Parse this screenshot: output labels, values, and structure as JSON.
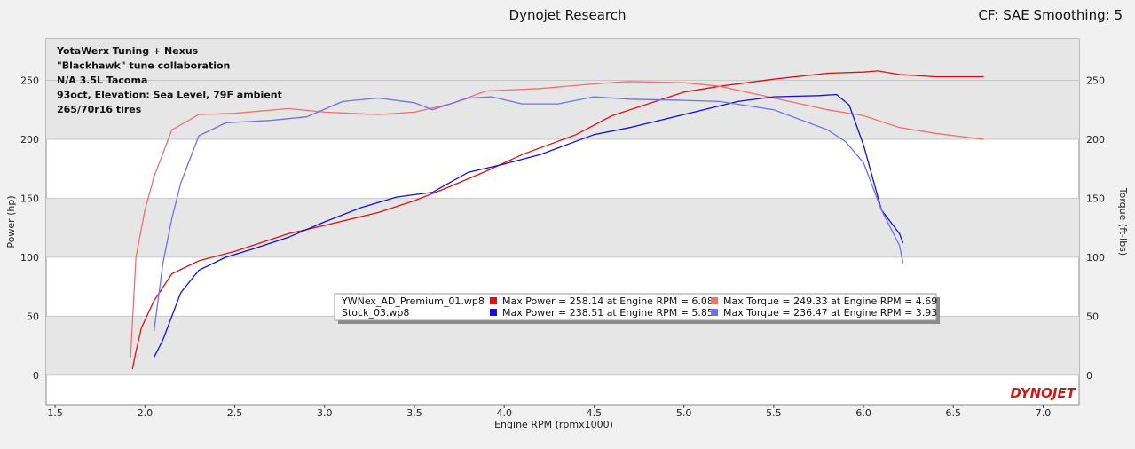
{
  "header": {
    "title": "Dynojet Research",
    "settings": "CF: SAE Smoothing: 5"
  },
  "chart_data": {
    "type": "line",
    "xlabel": "Engine RPM (rpmx1000)",
    "ylabel_left": "Power (hp)",
    "ylabel_right": "Torque (ft-lbs)",
    "xlim": [
      1.45,
      7.2
    ],
    "ylim": [
      -25,
      285
    ],
    "x_ticks": [
      "1.5",
      "2.0",
      "2.5",
      "3.0",
      "3.5",
      "4.0",
      "4.5",
      "5.0",
      "5.5",
      "6.0",
      "6.5",
      "7.0"
    ],
    "y_ticks": [
      "0",
      "50",
      "100",
      "150",
      "200",
      "250"
    ],
    "grid": true,
    "notes": [
      "YotaWerx Tuning + Nexus",
      "\"Blackhawk\" tune collaboration",
      "N/A 3.5L Tacoma",
      "93oct, Elevation: Sea Level, 79F ambient",
      "265/70r16 tires"
    ],
    "legend": [
      {
        "run": "YWNex_AD_Premium_01.wp8",
        "power_text": "Max Power = 258.14 at Engine RPM = 6.08",
        "torque_text": "Max Torque = 249.33 at Engine RPM = 4.69",
        "power_color": "#e01010",
        "torque_color": "#f07070"
      },
      {
        "run": "Stock_03.wp8",
        "power_text": "Max Power = 238.51 at Engine RPM = 5.85",
        "torque_text": "Max Torque = 236.47 at Engine RPM = 3.93",
        "power_color": "#1010e0",
        "torque_color": "#7070f0"
      }
    ],
    "logo": "DYNOJET",
    "series": [
      {
        "color": "#e01010",
        "x": [
          1.93,
          1.95,
          1.98,
          2.05,
          2.15,
          2.3,
          2.5,
          2.8,
          3.0,
          3.3,
          3.5,
          3.7,
          3.9,
          4.1,
          4.4,
          4.6,
          4.8,
          5.0,
          5.2,
          5.5,
          5.8,
          6.0,
          6.08,
          6.2,
          6.4,
          6.67
        ],
        "y": [
          5,
          20,
          40,
          63,
          86,
          97,
          105,
          120,
          127,
          138,
          148,
          160,
          173,
          187,
          204,
          220,
          230,
          240,
          245,
          251,
          256,
          257,
          258,
          255,
          253,
          253
        ]
      },
      {
        "color": "#f07070",
        "x": [
          1.92,
          1.95,
          2.0,
          2.05,
          2.15,
          2.3,
          2.5,
          2.8,
          3.0,
          3.3,
          3.5,
          3.7,
          3.9,
          4.2,
          4.5,
          4.69,
          5.0,
          5.2,
          5.5,
          5.8,
          6.0,
          6.2,
          6.4,
          6.67
        ],
        "y": [
          15,
          100,
          140,
          168,
          208,
          221,
          222,
          226,
          223,
          221,
          223,
          230,
          241,
          243,
          247,
          249,
          248,
          245,
          235,
          225,
          220,
          210,
          205,
          200
        ]
      },
      {
        "color": "#1010e0",
        "x": [
          2.05,
          2.1,
          2.2,
          2.3,
          2.45,
          2.6,
          2.8,
          3.0,
          3.2,
          3.4,
          3.6,
          3.8,
          4.0,
          4.2,
          4.5,
          4.7,
          5.0,
          5.3,
          5.5,
          5.75,
          5.85,
          5.92,
          6.0,
          6.1,
          6.2,
          6.22
        ],
        "y": [
          15,
          30,
          70,
          89,
          100,
          107,
          117,
          130,
          142,
          151,
          155,
          172,
          179,
          187,
          204,
          210,
          221,
          232,
          236,
          237,
          238,
          229,
          195,
          140,
          120,
          112
        ]
      },
      {
        "color": "#7070f0",
        "x": [
          2.05,
          2.1,
          2.15,
          2.2,
          2.3,
          2.45,
          2.7,
          2.9,
          3.1,
          3.3,
          3.5,
          3.6,
          3.8,
          3.93,
          4.1,
          4.3,
          4.5,
          4.7,
          5.0,
          5.2,
          5.5,
          5.8,
          5.9,
          6.0,
          6.1,
          6.2,
          6.22
        ],
        "y": [
          37,
          95,
          133,
          163,
          203,
          214,
          216,
          219,
          232,
          235,
          231,
          225,
          235,
          236,
          230,
          230,
          236,
          234,
          233,
          232,
          225,
          208,
          198,
          180,
          140,
          110,
          95
        ]
      }
    ]
  }
}
